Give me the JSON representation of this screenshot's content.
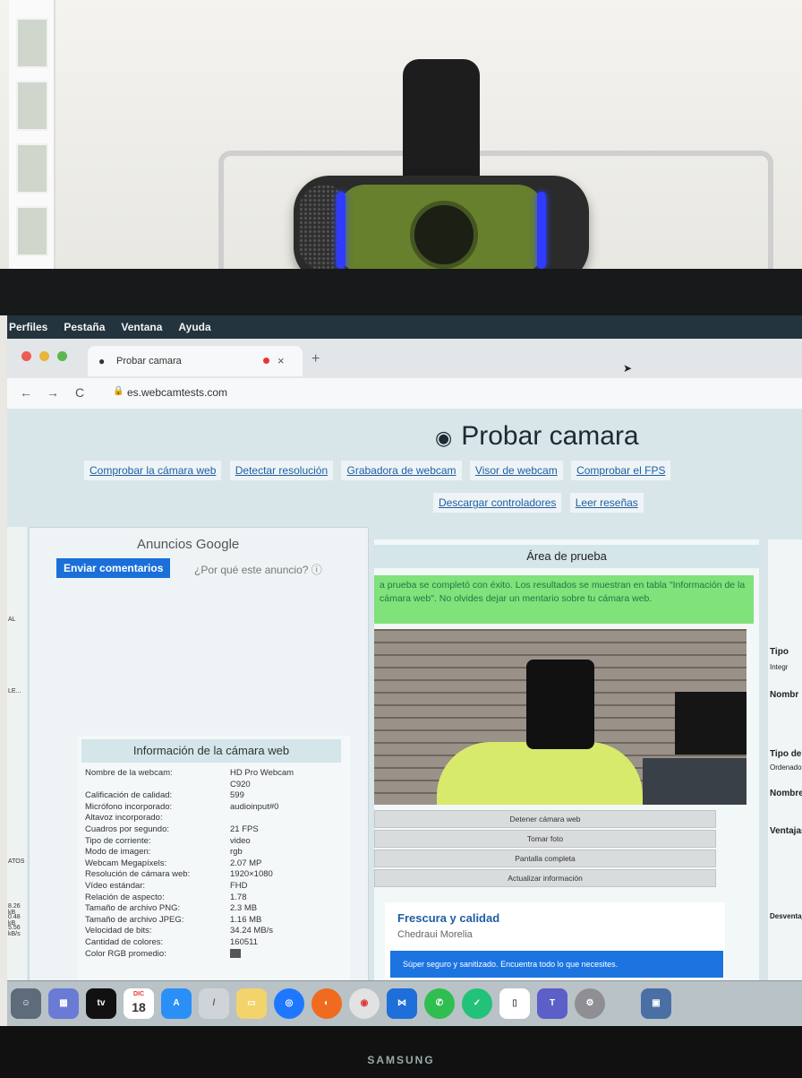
{
  "menubar": {
    "items": [
      "Perfiles",
      "Pestaña",
      "Ventana",
      "Ayuda"
    ]
  },
  "browser": {
    "tab_title": "Probar camara",
    "tab_close": "×",
    "new_tab": "+",
    "url": "es.webcamtests.com"
  },
  "page": {
    "title": "Probar camara",
    "nav": [
      "Comprobar la cámara web",
      "Detectar resolución",
      "Grabadora de webcam",
      "Visor de webcam",
      "Comprobar el FPS"
    ],
    "nav2": [
      "Descargar controladores",
      "Leer reseñas"
    ]
  },
  "ads": {
    "title": "Anuncios Google",
    "feedback": "Enviar comentarios",
    "why": "¿Por qué este anuncio? ⓘ"
  },
  "info": {
    "title": "Información de la cámara web",
    "rows": [
      [
        "Nombre de la webcam:",
        "HD Pro Webcam"
      ],
      [
        "",
        "C920"
      ],
      [
        "Calificación de calidad:",
        "599"
      ],
      [
        "Micrófono incorporado:",
        "audioinput#0"
      ],
      [
        "Altavoz incorporado:",
        ""
      ],
      [
        "Cuadros por segundo:",
        "21 FPS"
      ],
      [
        "Tipo de corriente:",
        "video"
      ],
      [
        "Modo de imagen:",
        "rgb"
      ],
      [
        "Webcam Megapíxels:",
        "2.07 MP"
      ],
      [
        "Resolución de cámara web:",
        "1920×1080"
      ],
      [
        "Vídeo estándar:",
        "FHD"
      ],
      [
        "Relación de aspecto:",
        "1.78"
      ],
      [
        "Tamaño de archivo PNG:",
        "2.3 MB"
      ],
      [
        "Tamaño de archivo JPEG:",
        "1.16 MB"
      ],
      [
        "Velocidad de bits:",
        "34.24 MB/s"
      ],
      [
        "Cantidad de colores:",
        "160511"
      ],
      [
        "Color RGB promedio:",
        ""
      ]
    ]
  },
  "test": {
    "title": "Área de prueba",
    "success": "a prueba se completó con éxito. Los resultados se muestran en tabla \"Información de la cámara web\". No olvides dejar un mentario sobre tu cámara web.",
    "buttons": [
      "Detener cámara web",
      "Tomar foto",
      "Pantalla completa",
      "Actualizar información"
    ]
  },
  "adcard": {
    "title": "Frescura y calidad",
    "subtitle": "Chedraui Morelia",
    "banner": "Súper seguro y sanitizado. Encuentra todo lo que necesites."
  },
  "right": {
    "labels": [
      "Tipo",
      "Integr",
      "Nombr",
      "Tipo de",
      "Ordenado",
      "Nombre d",
      "Ventajas d",
      "Desventajas d"
    ]
  },
  "left_side": {
    "labels": [
      "AL",
      "LE...",
      "ATOS",
      "8.26 kB",
      "0.48 kB",
      "5.56 kB/s"
    ]
  },
  "dock": {
    "calendar_month": "DIC",
    "calendar_day": "18",
    "tv": "tv"
  },
  "monitor_brand": "SAMSUNG",
  "colors": {
    "menubar": "#23343f",
    "link": "#1f5fa3",
    "success": "#7fe27a",
    "ad_button": "#1a6fd9",
    "led": "#2f3cff"
  }
}
